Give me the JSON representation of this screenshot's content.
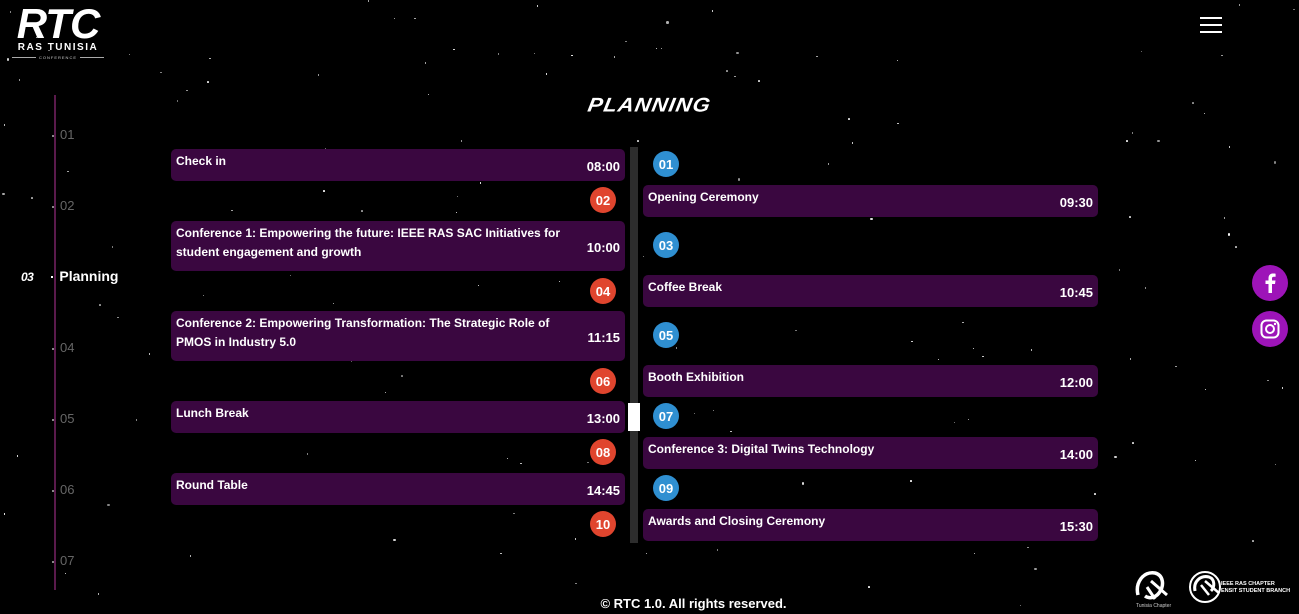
{
  "logo": {
    "main": "RTC",
    "sub": "RAS TUNISIA",
    "tag": "CONFERENCE"
  },
  "title": "Planning",
  "side_nav": [
    {
      "num": "01",
      "label": ""
    },
    {
      "num": "02",
      "label": ""
    },
    {
      "num": "03",
      "label": "Planning",
      "active": true
    },
    {
      "num": "04",
      "label": ""
    },
    {
      "num": "05",
      "label": ""
    },
    {
      "num": "06",
      "label": ""
    },
    {
      "num": "07",
      "label": ""
    }
  ],
  "events": [
    {
      "num": "01",
      "title": "Check in",
      "time": "08:00",
      "side": "left"
    },
    {
      "num": "02",
      "title": "Opening Ceremony",
      "time": "09:30",
      "side": "right"
    },
    {
      "num": "03",
      "title": "Conference 1: Empowering the future: IEEE RAS SAC Initiatives for student engagement and growth",
      "time": "10:00",
      "side": "left"
    },
    {
      "num": "04",
      "title": "Coffee Break",
      "time": "10:45",
      "side": "right"
    },
    {
      "num": "05",
      "title": "Conference 2: Empowering Transformation: The Strategic Role of PMOS in Industry 5.0",
      "time": "11:15",
      "side": "left"
    },
    {
      "num": "06",
      "title": "Booth Exhibition",
      "time": "12:00",
      "side": "right"
    },
    {
      "num": "07",
      "title": "Lunch Break",
      "time": "13:00",
      "side": "left"
    },
    {
      "num": "08",
      "title": "Conference 3: Digital Twins Technology",
      "time": "14:00",
      "side": "right"
    },
    {
      "num": "09",
      "title": "Round Table",
      "time": "14:45",
      "side": "left"
    },
    {
      "num": "10",
      "title": "Awards and Closing Ceremony",
      "time": "15:30",
      "side": "right"
    }
  ],
  "social": [
    {
      "name": "facebook-icon"
    },
    {
      "name": "instagram-icon"
    }
  ],
  "footer": "© RTC 1.0. All rights reserved.",
  "sponsors": {
    "left": "Tunisia Chapter",
    "right_line1": "IEEE RAS CHAPTER",
    "right_line2": "ENSIT STUDENT BRANCH"
  },
  "colors": {
    "card": "#3a0740",
    "badge_left": "#e0452e",
    "badge_right": "#2f8fd1",
    "social": "#9d14b8",
    "rail": "#5a1a4c"
  }
}
